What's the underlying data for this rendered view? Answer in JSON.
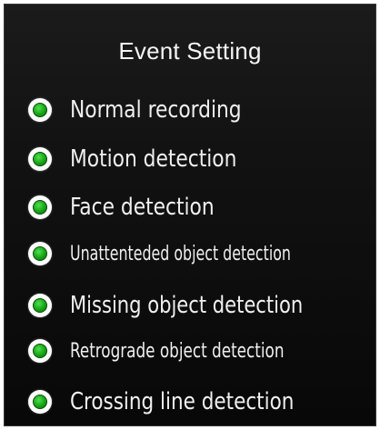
{
  "panel": {
    "title": "Event Setting",
    "options": [
      {
        "label": "Normal recording",
        "selected": true
      },
      {
        "label": "Motion detection",
        "selected": true
      },
      {
        "label": "Face detection",
        "selected": true
      },
      {
        "label": "Unattenteded object detection",
        "selected": true
      },
      {
        "label": "Missing object detection",
        "selected": true
      },
      {
        "label": "Retrograde object detection",
        "selected": true
      },
      {
        "label": "Crossing line detection",
        "selected": true
      }
    ]
  },
  "colors": {
    "background": "#121212",
    "radio_ring": "#ffffff",
    "radio_dot": "#16a316",
    "text": "#efefef"
  }
}
